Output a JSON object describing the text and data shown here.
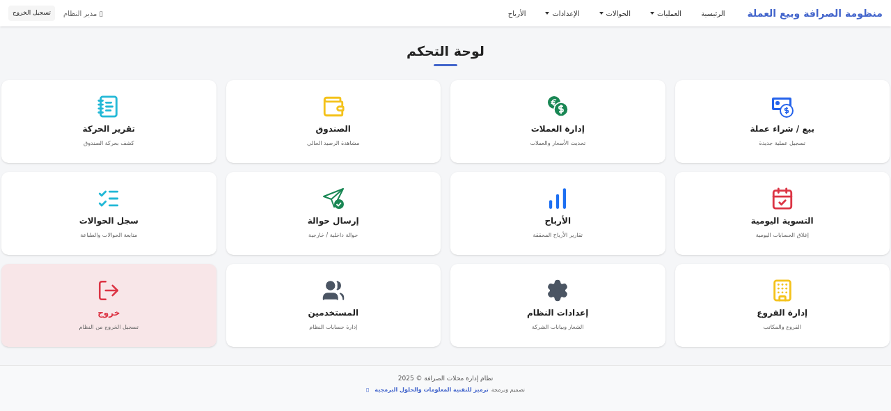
{
  "navbar": {
    "brand": "منظومة الصرافة وبيع العملة",
    "items": [
      {
        "label": "الرئيسية",
        "dropdown": false
      },
      {
        "label": "العمليات",
        "dropdown": true
      },
      {
        "label": "الحوالات",
        "dropdown": true
      },
      {
        "label": "الإعدادات",
        "dropdown": true
      },
      {
        "label": "الأرباح",
        "dropdown": false
      }
    ],
    "user": {
      "icon_glyph": "▯",
      "name": "مدير النظام"
    },
    "logout": "تسجيل الخروج"
  },
  "page_title": "لوحة التحكم",
  "cards": [
    {
      "title": "بيع / شراء عملة",
      "subtitle": "تسجيل عملية جديدة",
      "danger": false
    },
    {
      "title": "إدارة العملات",
      "subtitle": "تحديث الأسعار والعملات",
      "danger": false
    },
    {
      "title": "الصندوق",
      "subtitle": "مشاهدة الرصيد الحالي",
      "danger": false
    },
    {
      "title": "تقرير الحركة",
      "subtitle": "كشف بحركة الصندوق",
      "danger": false
    },
    {
      "title": "التسوية اليومية",
      "subtitle": "إغلاق الحسابات اليومية",
      "danger": false
    },
    {
      "title": "الأرباح",
      "subtitle": "تقارير الأرباح المحققة",
      "danger": false
    },
    {
      "title": "إرسال حوالة",
      "subtitle": "حوالة داخلية / خارجية",
      "danger": false
    },
    {
      "title": "سجل الحوالات",
      "subtitle": "متابعة الحوالات والطباعة",
      "danger": false
    },
    {
      "title": "إدارة الفروع",
      "subtitle": "الفروع والمكاتب",
      "danger": false
    },
    {
      "title": "إعدادات النظام",
      "subtitle": "الشعار وبيانات الشركة",
      "danger": false
    },
    {
      "title": "المستخدمين",
      "subtitle": "إدارة حسابات النظام",
      "danger": false
    },
    {
      "title": "خروج",
      "subtitle": "تسجيل الخروج من النظام",
      "danger": true
    }
  ],
  "footer": {
    "copyright": "نظام إدارة محلات الصرافة © 2025",
    "credit_prefix": "تصميم وبرمجة",
    "credit_link": "ترميز للتقنية المعلومات والحلول البرمجية",
    "credit_glyph": "▯"
  }
}
